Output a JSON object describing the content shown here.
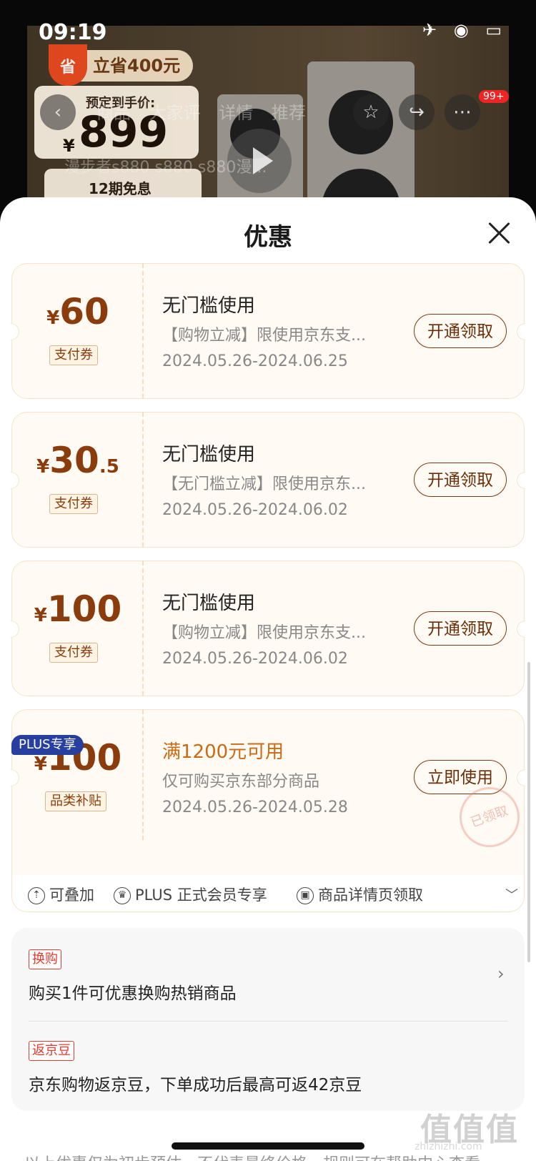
{
  "status_bar": {
    "time": "09:19",
    "icons": "✈ ◉ ▭"
  },
  "product_bg": {
    "save_mark": "省",
    "save_text": "立省400元",
    "price_label": "预定到手价:",
    "currency": "¥",
    "price": "899",
    "tabs": "商品 大家评 详情 推荐",
    "cart_badge": "99+",
    "search_text": "漫步者s880 s880 s880漫...",
    "installment": "12期免息"
  },
  "sheet": {
    "title": "优惠",
    "coupons": [
      {
        "currency": "¥",
        "amount": "60",
        "decimal": "",
        "tag": "支付券",
        "title": "无门槛使用",
        "desc": "【购物立减】限使用京东支...",
        "date": "2024.05.26-2024.06.25",
        "button": "开通领取"
      },
      {
        "currency": "¥",
        "amount": "30",
        "decimal": ".5",
        "tag": "支付券",
        "title": "无门槛使用",
        "desc": "【无门槛立减】限使用京东...",
        "date": "2024.05.26-2024.06.02",
        "button": "开通领取"
      },
      {
        "currency": "¥",
        "amount": "100",
        "decimal": "",
        "tag": "支付券",
        "title": "无门槛使用",
        "desc": "【购物立减】限使用京东支...",
        "date": "2024.05.26-2024.06.02",
        "button": "开通领取"
      },
      {
        "badge": "PLUS专享",
        "currency": "¥",
        "amount": "100",
        "decimal": "",
        "tag": "品类补贴",
        "title": "满1200元可用",
        "desc": "仅可购买京东部分商品",
        "date": "2024.05.26-2024.05.28",
        "button": "立即使用",
        "stamp": "已领取"
      }
    ],
    "features": [
      "可叠加",
      "PLUS 正式会员专享",
      "商品详情页领取"
    ],
    "offers": [
      {
        "tag": "换购",
        "text": "购买1件可优惠换购热销商品"
      },
      {
        "tag": "返京豆",
        "text": "京东购物返京豆，下单成功后最高可返42京豆"
      }
    ],
    "footer": "以上优惠仅为初步预估，不代表最终价格，规则可在帮助中心查看"
  },
  "watermark": {
    "logo": "值值值",
    "site": "zhizhizhi.com"
  },
  "colors": {
    "coupon_bg": "#fffaf3",
    "amount": "#8a3c0c",
    "plus_badge": "#273f9f",
    "tag_red": "#e33b2e"
  }
}
